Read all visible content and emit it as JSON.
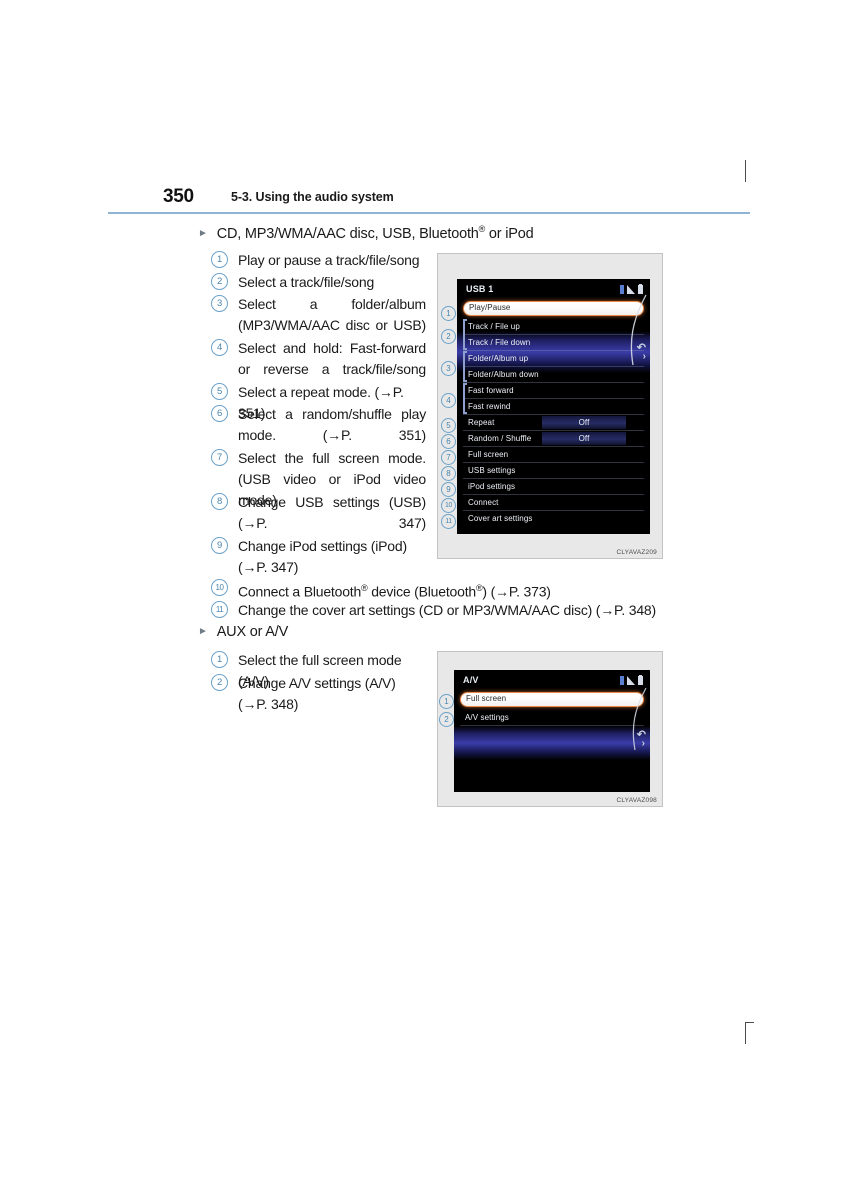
{
  "page": {
    "number": "350",
    "header_title": "5-3. Using the audio system"
  },
  "sections": [
    {
      "id": "cd-section",
      "heading": "CD, MP3/WMA/AAC disc, USB, Bluetooth® or iPod",
      "heading_parts": {
        "before": "CD, MP3/WMA/AAC disc, USB, Bluetooth",
        "superscript": "®",
        "after": " or iPod"
      },
      "items": [
        {
          "num": "①",
          "text": "Play or pause a track/file/song"
        },
        {
          "num": "②",
          "text": "Select a track/file/song"
        },
        {
          "num": "③",
          "text": "Select a folder/album (MP3/WMA/AAC disc or USB)"
        },
        {
          "num": "④",
          "text": "Select and hold: Fast-forward or reverse a track/file/song"
        },
        {
          "num": "⑤",
          "text": "Select a repeat mode. (→P. 351)"
        },
        {
          "num": "⑥",
          "text": "Select a random/shuffle play mode. (→P. 351)"
        },
        {
          "num": "⑦",
          "text": "Select the full screen mode. (USB video or iPod video mode)"
        },
        {
          "num": "⑧",
          "text": "Change USB settings (USB) (→P. 347)"
        },
        {
          "num": "⑨",
          "text": "Change iPod settings (iPod) (→P. 347)"
        },
        {
          "num": "⑩",
          "text_parts": {
            "p1": "Connect a Bluetooth",
            "sup1": "®",
            "p2": " device (Bluetooth",
            "sup2": "®",
            "p3": ") (→P. 373)"
          }
        },
        {
          "num": "⑪",
          "text": "Change the cover art settings (CD or MP3/WMA/AAC disc) (→P. 348)"
        }
      ]
    },
    {
      "id": "aux-section",
      "heading": "AUX or A/V",
      "items": [
        {
          "num": "①",
          "text": "Select the full screen mode (A/V)"
        },
        {
          "num": "②",
          "text": "Change A/V settings (A/V) (→P. 348)"
        }
      ]
    }
  ],
  "figures": [
    {
      "id": "usb-figure",
      "caption": "CLYAVAZ209",
      "screen": {
        "title": "USB 1",
        "status_icons": [
          "bluetooth-icon",
          "signal-icon",
          "battery-icon"
        ],
        "menu": [
          {
            "label": "Play/Pause",
            "selected": true,
            "callout": "1"
          },
          {
            "label": "Track / File up",
            "callout": "2",
            "group_start": true
          },
          {
            "label": "Track / File down"
          },
          {
            "label": "Folder/Album up",
            "callout": "3",
            "group_start": true
          },
          {
            "label": "Folder/Album down"
          },
          {
            "label": "Fast forward",
            "callout": "4",
            "group_start": true
          },
          {
            "label": "Fast rewind"
          },
          {
            "label": "Repeat",
            "value": "Off",
            "callout": "5"
          },
          {
            "label": "Random / Shuffle",
            "value": "Off",
            "callout": "6"
          },
          {
            "label": "Full screen",
            "callout": "7"
          },
          {
            "label": "USB settings",
            "callout": "8"
          },
          {
            "label": "iPod settings",
            "callout": "9"
          },
          {
            "label": "Connect",
            "callout": "10"
          },
          {
            "label": "Cover art settings",
            "callout": "11"
          }
        ]
      }
    },
    {
      "id": "av-figure",
      "caption": "CLYAVAZ098",
      "screen": {
        "title": "A/V",
        "status_icons": [
          "bluetooth-icon",
          "signal-icon",
          "battery-icon"
        ],
        "menu": [
          {
            "label": "Full screen",
            "selected": true,
            "callout": "1"
          },
          {
            "label": "A/V settings",
            "callout": "2"
          }
        ]
      }
    }
  ],
  "colors": {
    "header_rule": "#8fb4d4",
    "callout_circle": "#6ba2c9",
    "callout_text": "#4a86ae",
    "screen_background": "#000000",
    "selected_row_border": "#e98a4a",
    "highlight_band": "#3e40b2"
  }
}
